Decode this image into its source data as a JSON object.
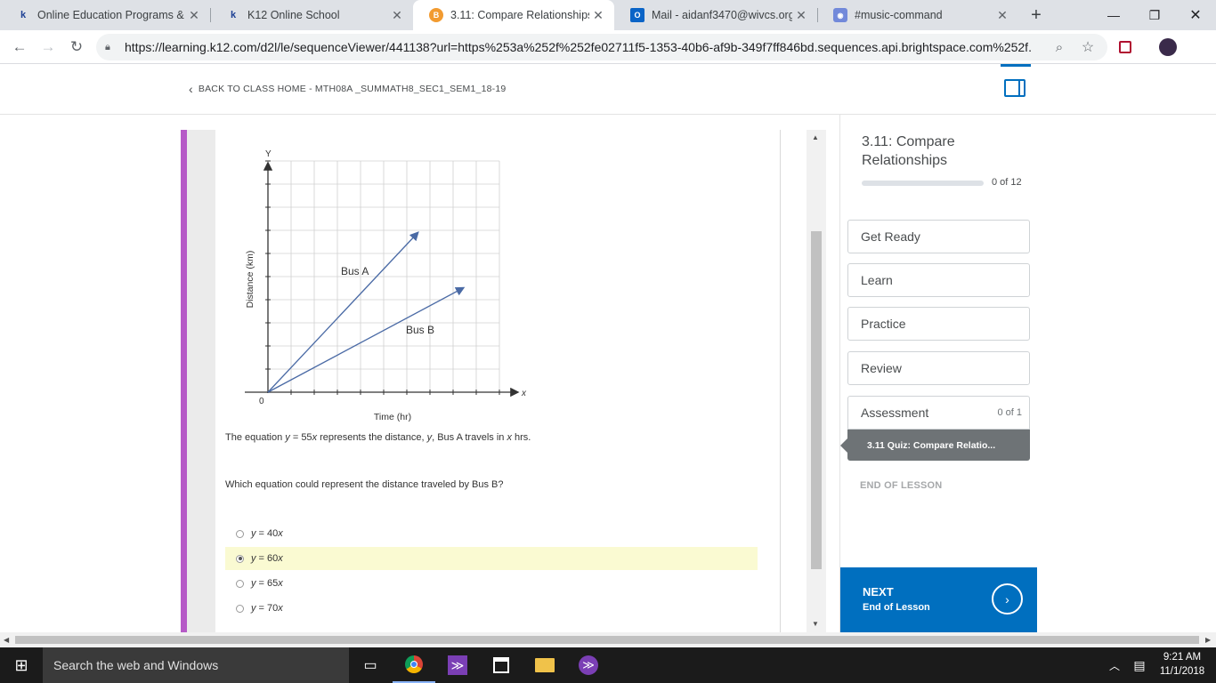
{
  "browser": {
    "tabs": [
      {
        "title": "Online Education Programs & ",
        "icon": "k12-icon",
        "active": false
      },
      {
        "title": "K12 Online School",
        "icon": "k12-icon",
        "active": false
      },
      {
        "title": "3.11: Compare Relationships - ",
        "icon": "brightspace-icon",
        "active": true
      },
      {
        "title": "Mail - aidanf3470@wivcs.org",
        "icon": "outlook-icon",
        "active": false
      },
      {
        "title": "#music-command",
        "icon": "discord-icon",
        "active": false
      }
    ],
    "url": "https://learning.k12.com/d2l/le/sequenceViewer/441138?url=https%253a%252f%252fe02711f5-1353-40b6-af9b-349f7ff846bd.sequences.api.brightspace.com%252f..."
  },
  "page": {
    "back_link": "BACK TO CLASS HOME - MTH08A _SUMMATH8_SEC1_SEM1_18-19"
  },
  "graph": {
    "y_axis_letter": "Y",
    "x_axis_letter": "x",
    "origin": "0",
    "ylabel": "Distance (km)",
    "xlabel": "Time (hr)",
    "bus_a": "Bus A",
    "bus_b": "Bus B",
    "line_color": "#4a6aa5"
  },
  "question": {
    "statement_pre": "The equation ",
    "statement_eq": "y",
    "statement_mid": " = 55",
    "statement_var": "x",
    "statement_post1": " represents the distance, ",
    "statement_y": "y",
    "statement_post2": ", Bus A travels in ",
    "statement_x": "x",
    "statement_post3": " hrs.",
    "prompt": "Which equation could represent the distance traveled by Bus B?",
    "choices": [
      {
        "y": "y",
        "eq": " = 40",
        "x": "x",
        "selected": false
      },
      {
        "y": "y",
        "eq": " = 60",
        "x": "x",
        "selected": true
      },
      {
        "y": "y",
        "eq": " = 65",
        "x": "x",
        "selected": false
      },
      {
        "y": "y",
        "eq": " = 70",
        "x": "x",
        "selected": false
      }
    ]
  },
  "sidebar": {
    "lesson_title": "3.11: Compare Relationships",
    "progress_text": "0 of 12",
    "progress_fraction": 0,
    "items": [
      {
        "label": "Get Ready"
      },
      {
        "label": "Learn"
      },
      {
        "label": "Practice"
      },
      {
        "label": "Review"
      },
      {
        "label": "Assessment",
        "count": "0 of 1"
      }
    ],
    "quiz_item": "3.11 Quiz: Compare Relatio...",
    "end_of_lesson": "END OF LESSON",
    "next_label": "NEXT",
    "next_sub": "End of Lesson"
  },
  "taskbar": {
    "search_placeholder": "Search the web and Windows",
    "time": "9:21 AM",
    "date": "11/1/2018"
  }
}
